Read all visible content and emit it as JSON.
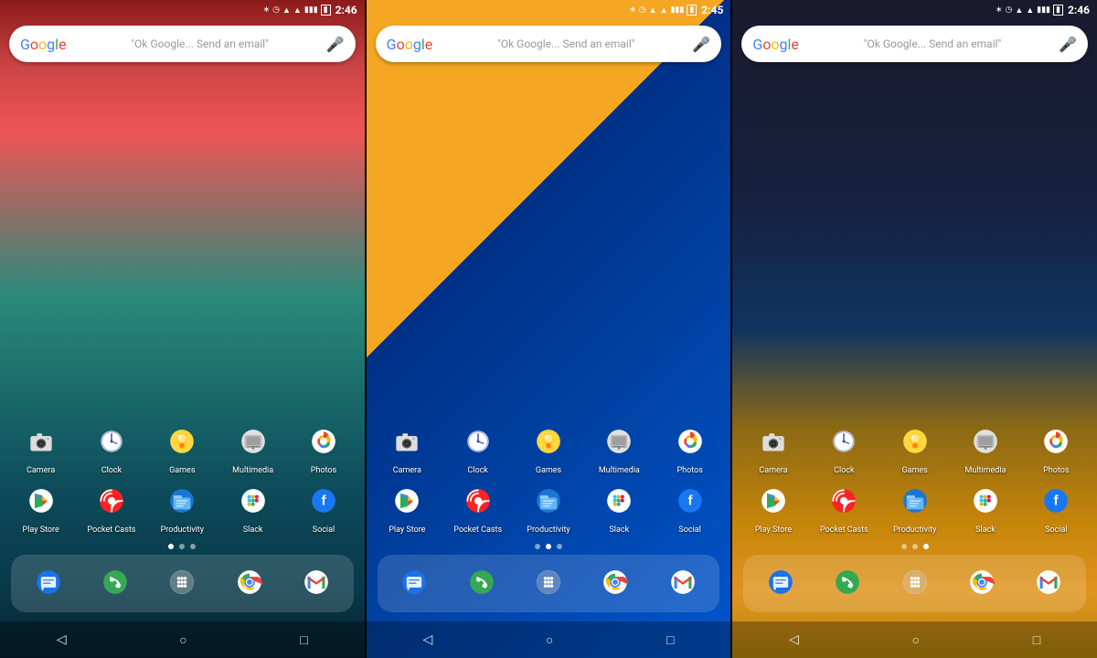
{
  "phones": [
    {
      "id": "phone-1",
      "wallpaper_class": "phone-1",
      "status": {
        "bluetooth": "⚙",
        "alarm": "⏰",
        "wifi": "▲",
        "signal": "▮▮",
        "battery": "🔋",
        "time": "2:46"
      },
      "search": {
        "google_label": "Google",
        "hint": "\"Ok Google... Send an email\"",
        "mic_label": "🎤"
      },
      "apps_row1": [
        {
          "id": "camera",
          "label": "Camera",
          "icon": "camera"
        },
        {
          "id": "clock",
          "label": "Clock",
          "icon": "clock"
        },
        {
          "id": "games",
          "label": "Games",
          "icon": "games"
        },
        {
          "id": "multimedia",
          "label": "Multimedia",
          "icon": "multimedia"
        },
        {
          "id": "photos",
          "label": "Photos",
          "icon": "photos"
        }
      ],
      "apps_row2": [
        {
          "id": "playstore",
          "label": "Play Store",
          "icon": "playstore"
        },
        {
          "id": "pocketcasts",
          "label": "Pocket Casts",
          "icon": "pocketcasts"
        },
        {
          "id": "productivity",
          "label": "Productivity",
          "icon": "productivity"
        },
        {
          "id": "slack",
          "label": "Slack",
          "icon": "slack"
        },
        {
          "id": "social",
          "label": "Social",
          "icon": "social"
        }
      ],
      "dots": [
        true,
        false,
        false
      ],
      "dock": [
        {
          "id": "messages",
          "label": "Messages",
          "icon": "messages"
        },
        {
          "id": "phone",
          "label": "Phone",
          "icon": "phone"
        },
        {
          "id": "dialer",
          "label": "Dialer",
          "icon": "dialer"
        },
        {
          "id": "chrome",
          "label": "Chrome",
          "icon": "chrome"
        },
        {
          "id": "gmail",
          "label": "Gmail",
          "icon": "gmail"
        }
      ]
    },
    {
      "id": "phone-2",
      "wallpaper_class": "phone-2",
      "status": {
        "bluetooth": "⚙",
        "alarm": "⏰",
        "wifi": "▲",
        "signal": "▮▮",
        "battery": "🔋",
        "time": "2:45"
      },
      "search": {
        "google_label": "Google",
        "hint": "\"Ok Google... Send an email\"",
        "mic_label": "🎤"
      },
      "apps_row1": [
        {
          "id": "camera",
          "label": "Camera",
          "icon": "camera"
        },
        {
          "id": "clock",
          "label": "Clock",
          "icon": "clock"
        },
        {
          "id": "games",
          "label": "Games",
          "icon": "games"
        },
        {
          "id": "multimedia",
          "label": "Multimedia",
          "icon": "multimedia"
        },
        {
          "id": "photos",
          "label": "Photos",
          "icon": "photos"
        }
      ],
      "apps_row2": [
        {
          "id": "playstore",
          "label": "Play Store",
          "icon": "playstore"
        },
        {
          "id": "pocketcasts",
          "label": "Pocket Casts",
          "icon": "pocketcasts"
        },
        {
          "id": "productivity",
          "label": "Productivity",
          "icon": "productivity"
        },
        {
          "id": "slack",
          "label": "Slack",
          "icon": "slack"
        },
        {
          "id": "social",
          "label": "Social",
          "icon": "social"
        }
      ],
      "dots": [
        false,
        true,
        false
      ],
      "dock": [
        {
          "id": "messages",
          "label": "Messages",
          "icon": "messages"
        },
        {
          "id": "phone",
          "label": "Phone",
          "icon": "phone"
        },
        {
          "id": "dialer",
          "label": "Dialer",
          "icon": "dialer"
        },
        {
          "id": "chrome",
          "label": "Chrome",
          "icon": "chrome"
        },
        {
          "id": "gmail",
          "label": "Gmail",
          "icon": "gmail"
        }
      ]
    },
    {
      "id": "phone-3",
      "wallpaper_class": "phone-3",
      "status": {
        "bluetooth": "⚙",
        "alarm": "⏰",
        "wifi": "▲",
        "signal": "▮▮",
        "battery": "🔋",
        "time": "2:46"
      },
      "search": {
        "google_label": "Google",
        "hint": "\"Ok Google... Send an email\"",
        "mic_label": "🎤"
      },
      "apps_row1": [
        {
          "id": "camera",
          "label": "Camera",
          "icon": "camera"
        },
        {
          "id": "clock",
          "label": "Clock",
          "icon": "clock"
        },
        {
          "id": "games",
          "label": "Games",
          "icon": "games"
        },
        {
          "id": "multimedia",
          "label": "Multimedia",
          "icon": "multimedia"
        },
        {
          "id": "photos",
          "label": "Photos",
          "icon": "photos"
        }
      ],
      "apps_row2": [
        {
          "id": "playstore",
          "label": "Play Store",
          "icon": "playstore"
        },
        {
          "id": "pocketcasts",
          "label": "Pocket Casts",
          "icon": "pocketcasts"
        },
        {
          "id": "productivity",
          "label": "Productivity",
          "icon": "productivity"
        },
        {
          "id": "slack",
          "label": "Slack",
          "icon": "slack"
        },
        {
          "id": "social",
          "label": "Social",
          "icon": "social"
        }
      ],
      "dots": [
        false,
        false,
        true
      ],
      "dock": [
        {
          "id": "messages",
          "label": "Messages",
          "icon": "messages"
        },
        {
          "id": "phone",
          "label": "Phone",
          "icon": "phone"
        },
        {
          "id": "dialer",
          "label": "Dialer",
          "icon": "dialer"
        },
        {
          "id": "chrome",
          "label": "Chrome",
          "icon": "chrome"
        },
        {
          "id": "gmail",
          "label": "Gmail",
          "icon": "gmail"
        }
      ]
    }
  ],
  "nav": {
    "back": "◁",
    "home": "○",
    "recents": "□"
  }
}
